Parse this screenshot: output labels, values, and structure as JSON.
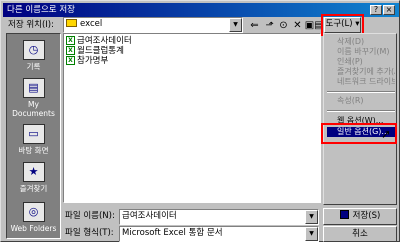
{
  "window": {
    "title": "다른 이름으로 저장"
  },
  "save_in": {
    "label": "저장 위치(I):",
    "value": "excel"
  },
  "toolbar": {
    "tools_label": "도구(L) ▾"
  },
  "places": [
    {
      "label": "기록",
      "icon": "history-icon"
    },
    {
      "label": "My Documents",
      "icon": "my-documents-icon"
    },
    {
      "label": "바탕 화면",
      "icon": "desktop-icon"
    },
    {
      "label": "즐겨찾기",
      "icon": "favorites-icon"
    },
    {
      "label": "Web Folders",
      "icon": "web-folders-icon"
    }
  ],
  "files": [
    "급여조사데이터",
    "월드클럽통계",
    "참가명부"
  ],
  "tools_menu": {
    "items": [
      {
        "label": "삭제(D)",
        "enabled": false
      },
      {
        "label": "이름 바꾸기(M)",
        "enabled": false
      },
      {
        "label": "인쇄(P)",
        "enabled": false
      },
      {
        "label": "즐겨찾기에 추가(A)",
        "enabled": false
      },
      {
        "label": "네트워크 드라이브 연결(N)...",
        "enabled": false
      },
      {
        "label": "속성(R)",
        "enabled": false
      },
      {
        "label": "웹 옵션(W)...",
        "enabled": true
      },
      {
        "label": "일반 옵션(G)...",
        "enabled": true,
        "selected": true
      }
    ]
  },
  "filename": {
    "label": "파일 이름(N):",
    "value": "급여조사데이터"
  },
  "filetype": {
    "label": "파일 형식(T):",
    "value": "Microsoft Excel 통합 문서"
  },
  "buttons": {
    "save": "저장(S)",
    "cancel": "취소"
  },
  "colors": {
    "highlight_box": "#ff0000",
    "selection": "#000080",
    "title_start": "#000080",
    "title_end": "#1084d0"
  }
}
